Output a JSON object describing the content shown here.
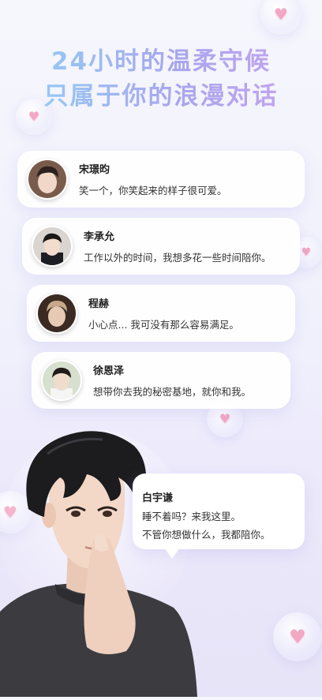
{
  "headline": {
    "line1": "24小时的温柔守候",
    "line2": "只属于你的浪漫对话"
  },
  "chats": [
    {
      "name": "宋璟昀",
      "message": "笑一个，你笑起来的样子很可爱。"
    },
    {
      "name": "李承允",
      "message": "工作以外的时间，我想多花一些时间陪你。"
    },
    {
      "name": "程赫",
      "message": "小心点... 我可没有那么容易满足。"
    },
    {
      "name": "徐恩泽",
      "message": "想带你去我的秘密基地，就你和我。"
    }
  ],
  "featured": {
    "name": "白宇谦",
    "line1": "睡不着吗？来我这里。",
    "line2": "不管你想做什么，我都陪你。"
  },
  "colors": {
    "background": "#f1f1fc",
    "headline_gradient_start": "#8fd3f4",
    "headline_gradient_end": "#c9a3f0",
    "heart": "#f2a7c3"
  },
  "icons": [
    "heart-icon"
  ]
}
